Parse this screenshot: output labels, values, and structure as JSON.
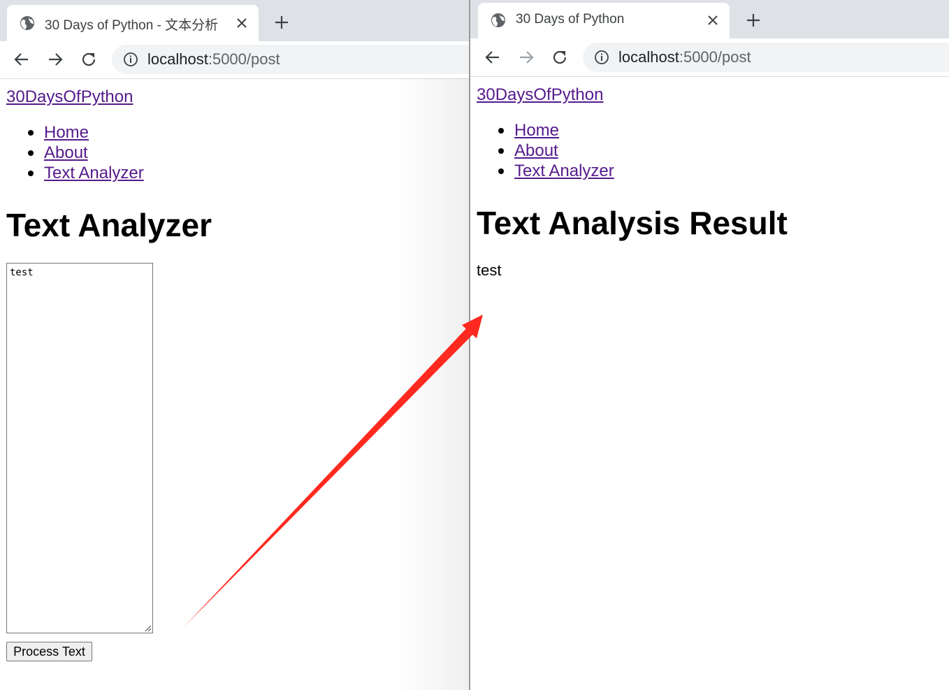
{
  "left_window": {
    "tab": {
      "title": "30 Days of Python - 文本分析",
      "icon": "globe-icon",
      "close_icon": "close-icon"
    },
    "new_tab_icon": "plus-icon",
    "toolbar": {
      "back_icon": "back-arrow-icon",
      "forward_icon": "forward-arrow-icon",
      "reload_icon": "reload-icon",
      "info_icon": "info-icon"
    },
    "url": {
      "host": "localhost",
      "rest": ":5000/post"
    },
    "page": {
      "brand": "30DaysOfPython",
      "nav": [
        "Home",
        "About",
        "Text Analyzer"
      ],
      "heading": "Text Analyzer",
      "textarea_value": "test",
      "button_label": "Process Text"
    }
  },
  "right_window": {
    "tab": {
      "title": "30 Days of Python",
      "icon": "globe-icon",
      "close_icon": "close-icon"
    },
    "new_tab_icon": "plus-icon",
    "toolbar": {
      "back_icon": "back-arrow-icon",
      "forward_icon": "forward-arrow-icon",
      "reload_icon": "reload-icon",
      "info_icon": "info-icon"
    },
    "url": {
      "host": "localhost",
      "rest": ":5000/post"
    },
    "page": {
      "brand": "30DaysOfPython",
      "nav": [
        "Home",
        "About",
        "Text Analyzer"
      ],
      "heading": "Text Analysis Result",
      "result_text": "test"
    }
  },
  "annotation": {
    "arrow_color": "#ff2a1f",
    "link_color": "#551a8b"
  }
}
